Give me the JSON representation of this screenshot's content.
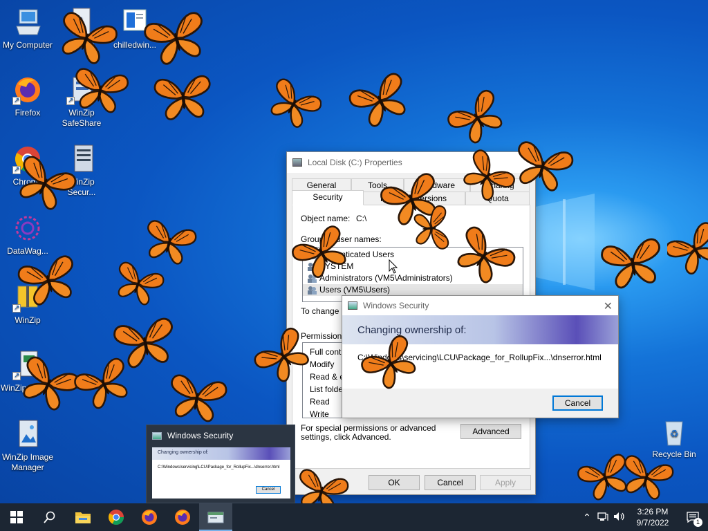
{
  "desktop": {
    "icons": [
      {
        "label": "My Computer"
      },
      {
        "label": "WinZip"
      },
      {
        "label": "chilledwin..."
      },
      {
        "label": "Firefox"
      },
      {
        "label": "WinZip SafeShare"
      },
      {
        "label": "Chrome"
      },
      {
        "label": "WinZip Secur..."
      },
      {
        "label": "DataWag..."
      },
      {
        "label": "WinZip"
      },
      {
        "label": "WinZip Dupli..."
      },
      {
        "label": "WinZip Image Manager"
      },
      {
        "label": "Recycle Bin"
      }
    ]
  },
  "properties_dialog": {
    "title": "Local Disk (C:) Properties",
    "tabs_row1": [
      "General",
      "Tools",
      "Hardware",
      "Sharing"
    ],
    "tabs_row2": [
      "Security",
      "Previous Versions",
      "Quota"
    ],
    "object_name_label": "Object name:",
    "object_name_value": "C:\\",
    "group_label": "Group or user names:",
    "users": [
      "Authenticated Users",
      "SYSTEM",
      "Administrators (VM5\\Administrators)",
      "Users (VM5\\Users)"
    ],
    "change_text": "To change permissions, click Edit.",
    "permissions_label": "Permissions for Users",
    "permissions": [
      "Full control",
      "Modify",
      "Read & execute",
      "List folder contents",
      "Read",
      "Write"
    ],
    "special_text": "For special permissions or advanced settings, click Advanced.",
    "advanced_button": "Advanced",
    "ok_button": "OK",
    "cancel_button": "Cancel",
    "apply_button": "Apply"
  },
  "security_dialog": {
    "title": "Windows Security",
    "heading": "Changing ownership of:",
    "path": "C:\\Windows\\servicing\\LCU\\Package_for_RollupFix...\\dnserror.html",
    "cancel_button": "Cancel"
  },
  "taskbar_preview": {
    "title": "Windows Security",
    "heading": "Changing ownership of:",
    "path": "C:\\Windows\\servicing\\LCU\\Package_for_RollupFix...\\dnserror.html",
    "cancel_button": "Cancel"
  },
  "taskbar": {
    "time": "3:26 PM",
    "date": "9/7/2022",
    "notification_count": "1",
    "apps": [
      "start-icon",
      "search-icon",
      "file-explorer-icon",
      "chrome-icon",
      "firefox-icon",
      "firefox-icon",
      "windows-security-icon"
    ]
  },
  "colors": {
    "accent": "#0078d7",
    "taskbar": "#1c2633",
    "butterfly": "#f07c1a"
  }
}
